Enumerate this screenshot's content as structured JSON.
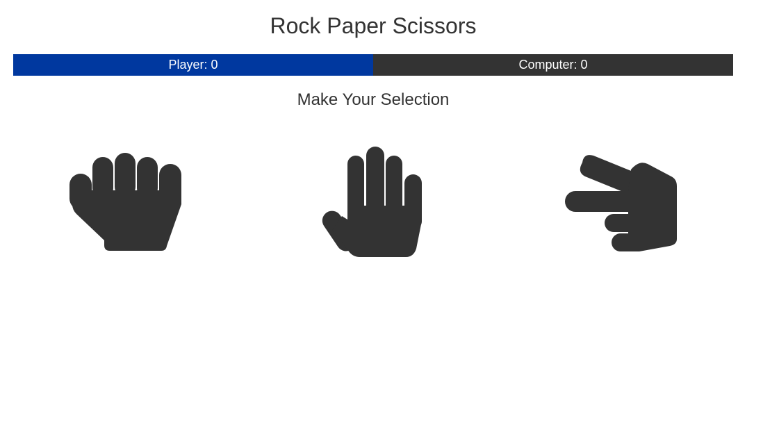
{
  "game": {
    "title": "Rock Paper Scissors",
    "prompt": "Make Your Selection"
  },
  "scoreboard": {
    "player": "Player: 0",
    "computer": "Computer: 0",
    "player_color": "#00389f",
    "computer_color": "#333333"
  },
  "choices": [
    {
      "id": "rock",
      "icon": "rock-fist-icon"
    },
    {
      "id": "paper",
      "icon": "paper-hand-icon"
    },
    {
      "id": "scissors",
      "icon": "scissors-hand-icon"
    }
  ],
  "colors": {
    "icon": "#333333",
    "text": "#333333",
    "background": "#ffffff"
  }
}
